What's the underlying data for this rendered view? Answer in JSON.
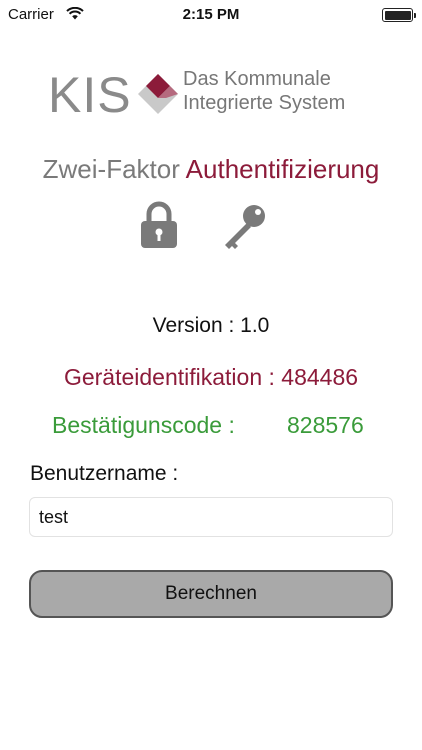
{
  "status_bar": {
    "carrier": "Carrier",
    "time": "2:15 PM"
  },
  "logo": {
    "mark": "KIS",
    "line1": "Das Kommunale",
    "line2": "Integrierte System"
  },
  "subtitle": {
    "part1": "Zwei-Faktor ",
    "part2": "Authentifizierung"
  },
  "icons": {
    "lock": "lock-icon",
    "key": "key-icon"
  },
  "version": "Version : 1.0",
  "device_id": "Geräteidentifikation : 484486",
  "confirmation": {
    "label": "Bestätigunscode :",
    "code": "828576"
  },
  "username": {
    "label": "Benutzername :",
    "value": "test"
  },
  "button": {
    "label": "Berechnen"
  },
  "colors": {
    "brand": "#8c1b3a",
    "success": "#3a9b3a",
    "button_bg": "#a9a9a9"
  }
}
